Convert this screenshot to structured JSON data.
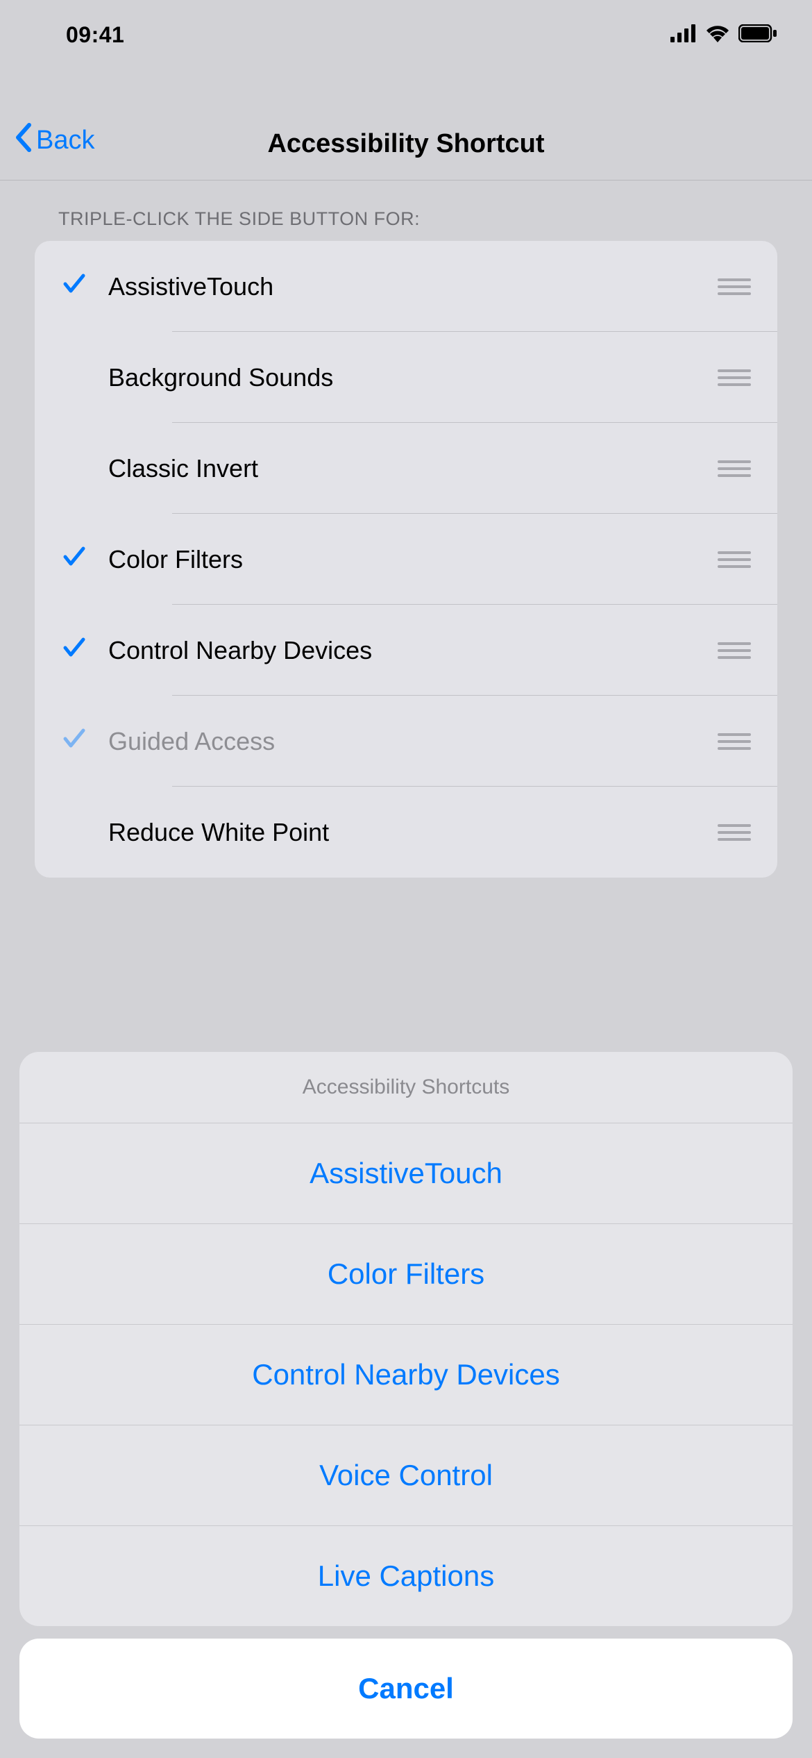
{
  "status": {
    "time": "09:41"
  },
  "nav": {
    "back": "Back",
    "title": "Accessibility Shortcut"
  },
  "section_header": "TRIPLE-CLICK THE SIDE BUTTON FOR:",
  "rows": [
    {
      "label": "AssistiveTouch",
      "checked": true,
      "faded": false
    },
    {
      "label": "Background Sounds",
      "checked": false,
      "faded": false
    },
    {
      "label": "Classic Invert",
      "checked": false,
      "faded": false
    },
    {
      "label": "Color Filters",
      "checked": true,
      "faded": false
    },
    {
      "label": "Control Nearby Devices",
      "checked": true,
      "faded": false
    },
    {
      "label": "Guided Access",
      "checked": true,
      "faded": true
    },
    {
      "label": "Reduce White Point",
      "checked": false,
      "faded": false
    }
  ],
  "sheet": {
    "title": "Accessibility Shortcuts",
    "options": [
      "AssistiveTouch",
      "Color Filters",
      "Control Nearby Devices",
      "Voice Control",
      "Live Captions"
    ],
    "cancel": "Cancel"
  }
}
